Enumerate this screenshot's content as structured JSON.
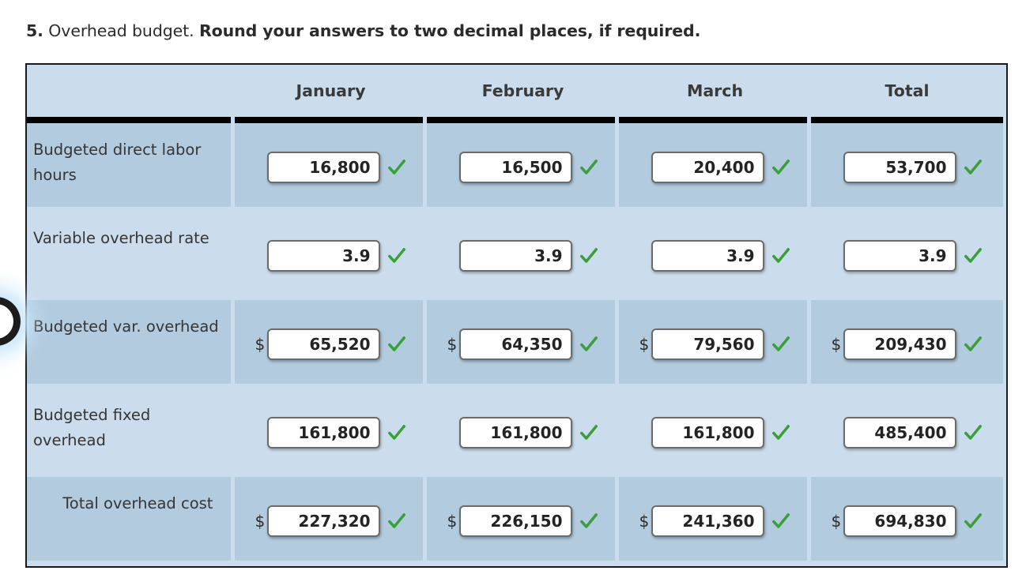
{
  "prompt": {
    "number": "5.",
    "normal_text": " Overhead budget. ",
    "bold_text": "Round your answers to two decimal places, if required."
  },
  "colors": {
    "row_dark": "#b2cbdf",
    "row_light": "#cbdcec",
    "header_bg": "#cbdcec",
    "check_green": "#3a9e3a",
    "border": "#1a1a1a",
    "input_border": "#6b6b6b"
  },
  "table": {
    "columns": [
      "",
      "January",
      "February",
      "March",
      "Total"
    ],
    "rows": [
      {
        "label": "Budgeted direct labor hours",
        "shade": "dark",
        "currency": false,
        "values": [
          "16,800",
          "16,500",
          "20,400",
          "53,700"
        ],
        "status": [
          "correct",
          "correct",
          "correct",
          "correct"
        ]
      },
      {
        "label": "Variable overhead rate",
        "shade": "light",
        "currency": false,
        "values": [
          "3.9",
          "3.9",
          "3.9",
          "3.9"
        ],
        "status": [
          "correct",
          "correct",
          "correct",
          "correct"
        ]
      },
      {
        "label": "Budgeted var. overhead",
        "shade": "dark",
        "currency": true,
        "values": [
          "65,520",
          "64,350",
          "79,560",
          "209,430"
        ],
        "status": [
          "correct",
          "correct",
          "correct",
          "correct"
        ]
      },
      {
        "label": "Budgeted fixed overhead",
        "shade": "light",
        "currency": false,
        "values": [
          "161,800",
          "161,800",
          "161,800",
          "485,400"
        ],
        "status": [
          "correct",
          "correct",
          "correct",
          "correct"
        ]
      },
      {
        "label": "      Total overhead cost",
        "shade": "dark",
        "currency": true,
        "values": [
          "227,320",
          "226,150",
          "241,360",
          "694,830"
        ],
        "status": [
          "correct",
          "correct",
          "correct",
          "correct"
        ]
      }
    ]
  },
  "currency_symbol": "$",
  "icons": {
    "check": "check-icon"
  }
}
